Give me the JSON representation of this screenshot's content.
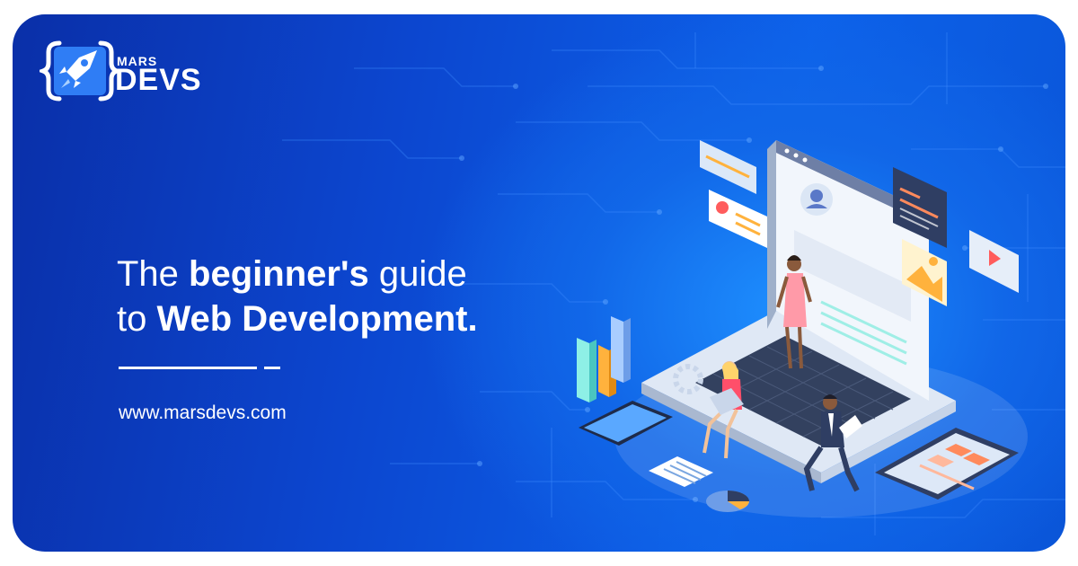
{
  "brand": {
    "top_word": "MARS",
    "bottom_word": "DEVS"
  },
  "headline": {
    "line1_prefix": "The ",
    "line1_bold": "beginner's",
    "line1_suffix": " guide",
    "line2_prefix": "to ",
    "line2_bold": "Web Development."
  },
  "website": "www.marsdevs.com",
  "colors": {
    "background_dark": "#0a2fa8",
    "background_light": "#1e90ff",
    "text": "#ffffff"
  }
}
